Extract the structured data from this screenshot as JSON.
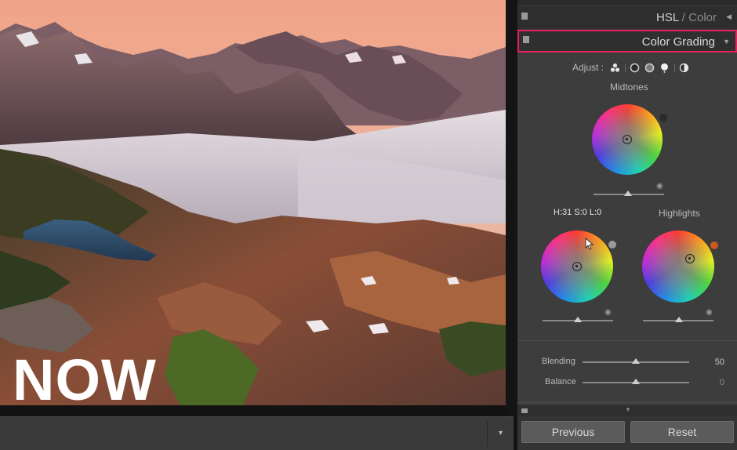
{
  "photo": {
    "overlay_text": "NOW"
  },
  "panel": {
    "hsl_header": {
      "title": "HSL",
      "separator": " / ",
      "subtitle": "Color"
    },
    "color_grading_header": {
      "title": "Color Grading"
    },
    "adjust": {
      "label": "Adjust :"
    },
    "midtones": {
      "label": "Midtones"
    },
    "shadows": {
      "readout": "H:31 S:0 L:0"
    },
    "highlights": {
      "label": "Highlights"
    },
    "blending": {
      "label": "Blending",
      "value": "50"
    },
    "balance": {
      "label": "Balance",
      "value": "0"
    }
  },
  "buttons": {
    "previous": "Previous",
    "reset": "Reset"
  },
  "colors": {
    "highlight_border": "#e3215a",
    "highlights_dot": "#c95a1f",
    "midtones_dot": "#2a2a2a",
    "shadows_dot": "#9a9a9a"
  }
}
